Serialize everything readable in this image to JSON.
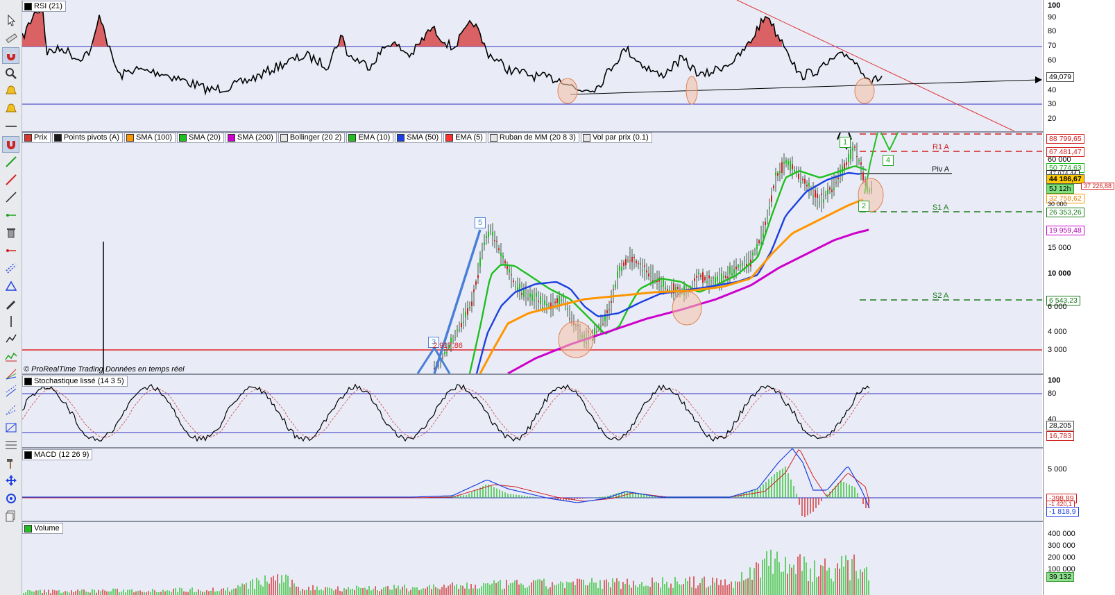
{
  "app": {
    "copyright": "© ProRealTime Trading  Données en temps réel"
  },
  "toolbar": {
    "tools": [
      "cursor-icon",
      "ruler-icon",
      "magnet-icon",
      "zoom-icon",
      "alarm-bell-icon",
      "alarm-bell-icon",
      "horizontal-line-icon",
      "magnet-active-icon",
      "trendline-green-icon",
      "trendline-red-icon",
      "trendline-icon",
      "ray-icon",
      "trash-icon",
      "segment-icon",
      "channel-icon",
      "fibonacci-icon",
      "brush-icon",
      "vertical-line-icon",
      "polyline-icon",
      "indicator-icon",
      "fan-icon",
      "pitchfork-icon",
      "fibonacci-fan-icon",
      "gann-icon",
      "fibonacci-retracement-icon",
      "hammer-icon",
      "move-icon",
      "drawing-settings-icon",
      "layers-icon"
    ]
  },
  "rsi_panel": {
    "label": "RSI (21)",
    "swatch": "#000000"
  },
  "legend": [
    {
      "label": "Prix",
      "swatch": "#d9362d"
    },
    {
      "label": "Points pivots (A)",
      "swatch": "#1a1a1a"
    },
    {
      "label": "SMA (100)",
      "swatch": "#ff9600"
    },
    {
      "label": "SMA (20)",
      "swatch": "#1fbf1f"
    },
    {
      "label": "SMA (200)",
      "swatch": "#cc00cc"
    },
    {
      "label": "Bollinger (20 2)",
      "swatch": "#e5e5e5"
    },
    {
      "label": "EMA (10)",
      "swatch": "#1fbf1f"
    },
    {
      "label": "SMA (50)",
      "swatch": "#1b3fe0"
    },
    {
      "label": "EMA (5)",
      "swatch": "#ff3030"
    },
    {
      "label": "Ruban de MM (20 8 3)",
      "swatch": "#e5e5e5"
    },
    {
      "label": "Vol par prix (0.1)",
      "swatch": "#e5e5e5"
    }
  ],
  "pivots": {
    "r1": "R1 A",
    "piv": "Piv A",
    "s1": "S1 A",
    "s2": "S2 A"
  },
  "waves": {
    "w2": "2",
    "w3": "3",
    "w4": "4",
    "w5": "5",
    "w1": "1"
  },
  "price_annotation": "2 917,86",
  "stoch_panel": {
    "label": "Stochastique lissé (14 3 5)"
  },
  "macd_panel": {
    "label": "MACD (12 26 9)"
  },
  "volume_panel": {
    "label": "Volume"
  },
  "axis": {
    "rsi_ticks": [
      "100",
      "90",
      "80",
      "70",
      "60",
      "50",
      "40",
      "30",
      "20"
    ],
    "rsi_value": "49,079",
    "price_ticks": [
      "60 000",
      "30 000",
      "15 000",
      "10 000",
      "6 000",
      "4 000",
      "3 000"
    ],
    "price_values": {
      "r1_top": "88 799,65",
      "r1": "67 481,47",
      "sma20": "50 774,63",
      "piv": "47 074,44",
      "last": "44 186,67",
      "timer": "5J 12h",
      "ema": "37 226,88",
      "sma100": "32 758,62",
      "s1": "26 353,26",
      "sma200": "19 959,48",
      "s2": "6 543,23"
    },
    "stoch_ticks": [
      "100",
      "80",
      "40"
    ],
    "stoch_values": {
      "k": "28,205",
      "d": "16,783"
    },
    "macd_ticks": [
      "5 000"
    ],
    "macd_values": {
      "a": "-398,89",
      "b": "-1 420,1",
      "c": "-1 818,9"
    },
    "volume_ticks": [
      "400 000",
      "300 000",
      "200 000",
      "100 000"
    ],
    "volume_value": "39 132"
  },
  "colors": {
    "panel_bg": "#e9ecf7",
    "overbought": "#d84a4a",
    "trend_red": "#e03030",
    "level_blue": "#3030c0"
  }
}
